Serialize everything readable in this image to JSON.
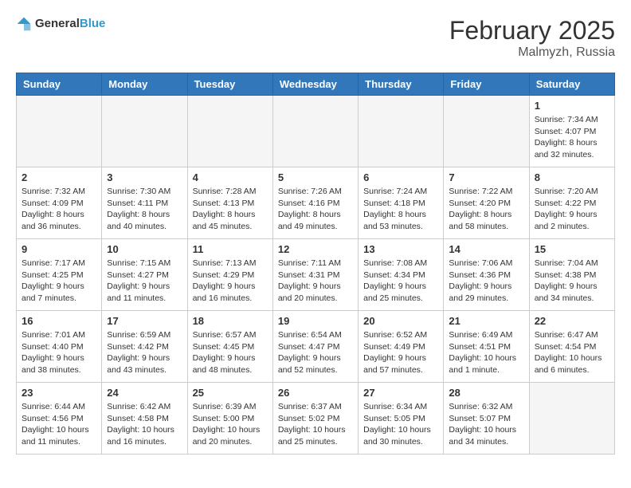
{
  "header": {
    "logo": {
      "general": "General",
      "blue": "Blue"
    },
    "title": "February 2025",
    "location": "Malmyzh, Russia"
  },
  "weekdays": [
    "Sunday",
    "Monday",
    "Tuesday",
    "Wednesday",
    "Thursday",
    "Friday",
    "Saturday"
  ],
  "days": [
    {
      "date": "",
      "empty": true
    },
    {
      "date": "",
      "empty": true
    },
    {
      "date": "",
      "empty": true
    },
    {
      "date": "",
      "empty": true
    },
    {
      "date": "",
      "empty": true
    },
    {
      "date": "",
      "empty": true
    },
    {
      "date": 1,
      "sunrise": "Sunrise: 7:34 AM",
      "sunset": "Sunset: 4:07 PM",
      "daylight": "Daylight: 8 hours and 32 minutes."
    },
    {
      "date": 2,
      "sunrise": "Sunrise: 7:32 AM",
      "sunset": "Sunset: 4:09 PM",
      "daylight": "Daylight: 8 hours and 36 minutes."
    },
    {
      "date": 3,
      "sunrise": "Sunrise: 7:30 AM",
      "sunset": "Sunset: 4:11 PM",
      "daylight": "Daylight: 8 hours and 40 minutes."
    },
    {
      "date": 4,
      "sunrise": "Sunrise: 7:28 AM",
      "sunset": "Sunset: 4:13 PM",
      "daylight": "Daylight: 8 hours and 45 minutes."
    },
    {
      "date": 5,
      "sunrise": "Sunrise: 7:26 AM",
      "sunset": "Sunset: 4:16 PM",
      "daylight": "Daylight: 8 hours and 49 minutes."
    },
    {
      "date": 6,
      "sunrise": "Sunrise: 7:24 AM",
      "sunset": "Sunset: 4:18 PM",
      "daylight": "Daylight: 8 hours and 53 minutes."
    },
    {
      "date": 7,
      "sunrise": "Sunrise: 7:22 AM",
      "sunset": "Sunset: 4:20 PM",
      "daylight": "Daylight: 8 hours and 58 minutes."
    },
    {
      "date": 8,
      "sunrise": "Sunrise: 7:20 AM",
      "sunset": "Sunset: 4:22 PM",
      "daylight": "Daylight: 9 hours and 2 minutes."
    },
    {
      "date": 9,
      "sunrise": "Sunrise: 7:17 AM",
      "sunset": "Sunset: 4:25 PM",
      "daylight": "Daylight: 9 hours and 7 minutes."
    },
    {
      "date": 10,
      "sunrise": "Sunrise: 7:15 AM",
      "sunset": "Sunset: 4:27 PM",
      "daylight": "Daylight: 9 hours and 11 minutes."
    },
    {
      "date": 11,
      "sunrise": "Sunrise: 7:13 AM",
      "sunset": "Sunset: 4:29 PM",
      "daylight": "Daylight: 9 hours and 16 minutes."
    },
    {
      "date": 12,
      "sunrise": "Sunrise: 7:11 AM",
      "sunset": "Sunset: 4:31 PM",
      "daylight": "Daylight: 9 hours and 20 minutes."
    },
    {
      "date": 13,
      "sunrise": "Sunrise: 7:08 AM",
      "sunset": "Sunset: 4:34 PM",
      "daylight": "Daylight: 9 hours and 25 minutes."
    },
    {
      "date": 14,
      "sunrise": "Sunrise: 7:06 AM",
      "sunset": "Sunset: 4:36 PM",
      "daylight": "Daylight: 9 hours and 29 minutes."
    },
    {
      "date": 15,
      "sunrise": "Sunrise: 7:04 AM",
      "sunset": "Sunset: 4:38 PM",
      "daylight": "Daylight: 9 hours and 34 minutes."
    },
    {
      "date": 16,
      "sunrise": "Sunrise: 7:01 AM",
      "sunset": "Sunset: 4:40 PM",
      "daylight": "Daylight: 9 hours and 38 minutes."
    },
    {
      "date": 17,
      "sunrise": "Sunrise: 6:59 AM",
      "sunset": "Sunset: 4:42 PM",
      "daylight": "Daylight: 9 hours and 43 minutes."
    },
    {
      "date": 18,
      "sunrise": "Sunrise: 6:57 AM",
      "sunset": "Sunset: 4:45 PM",
      "daylight": "Daylight: 9 hours and 48 minutes."
    },
    {
      "date": 19,
      "sunrise": "Sunrise: 6:54 AM",
      "sunset": "Sunset: 4:47 PM",
      "daylight": "Daylight: 9 hours and 52 minutes."
    },
    {
      "date": 20,
      "sunrise": "Sunrise: 6:52 AM",
      "sunset": "Sunset: 4:49 PM",
      "daylight": "Daylight: 9 hours and 57 minutes."
    },
    {
      "date": 21,
      "sunrise": "Sunrise: 6:49 AM",
      "sunset": "Sunset: 4:51 PM",
      "daylight": "Daylight: 10 hours and 1 minute."
    },
    {
      "date": 22,
      "sunrise": "Sunrise: 6:47 AM",
      "sunset": "Sunset: 4:54 PM",
      "daylight": "Daylight: 10 hours and 6 minutes."
    },
    {
      "date": 23,
      "sunrise": "Sunrise: 6:44 AM",
      "sunset": "Sunset: 4:56 PM",
      "daylight": "Daylight: 10 hours and 11 minutes."
    },
    {
      "date": 24,
      "sunrise": "Sunrise: 6:42 AM",
      "sunset": "Sunset: 4:58 PM",
      "daylight": "Daylight: 10 hours and 16 minutes."
    },
    {
      "date": 25,
      "sunrise": "Sunrise: 6:39 AM",
      "sunset": "Sunset: 5:00 PM",
      "daylight": "Daylight: 10 hours and 20 minutes."
    },
    {
      "date": 26,
      "sunrise": "Sunrise: 6:37 AM",
      "sunset": "Sunset: 5:02 PM",
      "daylight": "Daylight: 10 hours and 25 minutes."
    },
    {
      "date": 27,
      "sunrise": "Sunrise: 6:34 AM",
      "sunset": "Sunset: 5:05 PM",
      "daylight": "Daylight: 10 hours and 30 minutes."
    },
    {
      "date": 28,
      "sunrise": "Sunrise: 6:32 AM",
      "sunset": "Sunset: 5:07 PM",
      "daylight": "Daylight: 10 hours and 34 minutes."
    },
    {
      "date": "",
      "empty": true
    },
    {
      "date": "",
      "empty": true
    },
    {
      "date": "",
      "empty": true
    },
    {
      "date": "",
      "empty": true
    },
    {
      "date": "",
      "empty": true
    },
    {
      "date": "",
      "empty": true
    },
    {
      "date": "",
      "empty": true
    }
  ]
}
